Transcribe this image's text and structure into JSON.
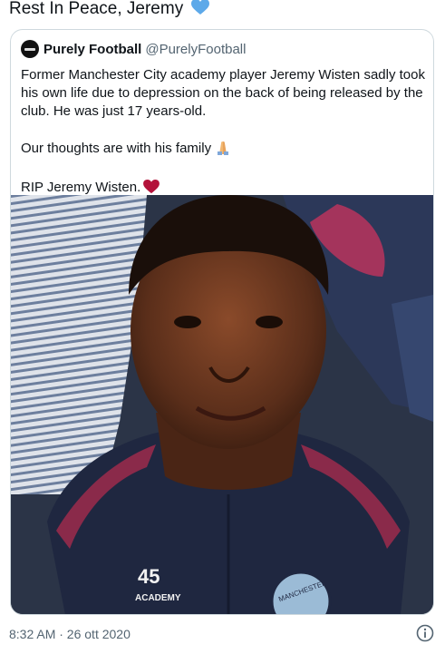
{
  "tweet": {
    "text": "Rest In Peace, Jeremy",
    "heart_emoji": "blue-heart-icon"
  },
  "quoted_tweet": {
    "display_name": "Purely Football",
    "handle": "@PurelyFootball",
    "paragraphs": [
      "Former Manchester City academy player Jeremy Wisten sadly took his own life due to depression on the back of being released by the club. He was just 17 years-old.",
      "Our thoughts are with his family",
      "RIP Jeremy Wisten."
    ],
    "emojis": [
      "folded-hands-icon",
      "red-heart-icon"
    ],
    "media": {
      "shirt_number": "45",
      "shirt_text": "ACADEMY",
      "badge_text": "MANCHESTER"
    }
  },
  "footer": {
    "timestamp": "8:32 AM · 26 ott 2020",
    "info_icon": "info-icon"
  },
  "colors": {
    "text": "#0f1419",
    "secondary": "#536471",
    "border": "#cfd9de",
    "heart_blue": "#5da9e9",
    "heart_red": "#b3123a"
  }
}
